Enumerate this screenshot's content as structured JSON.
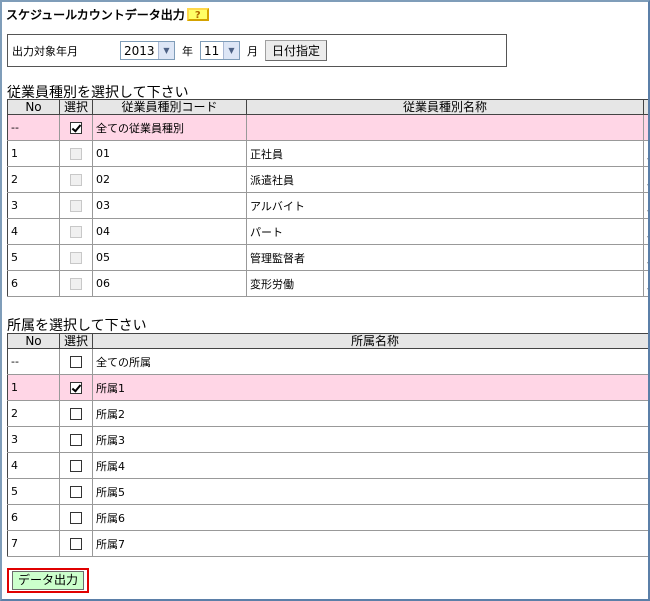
{
  "page": {
    "title": "スケジュールカウントデータ出力",
    "help_label": "?"
  },
  "filter": {
    "label": "出力対象年月",
    "year_value": "2013",
    "year_unit": "年",
    "month_value": "11",
    "month_unit": "月",
    "date_button": "日付指定"
  },
  "employee_section": {
    "title": "従業員種別を選択して下さい",
    "headers": [
      "No",
      "選択",
      "従業員種別コード",
      "従業員種別名称"
    ],
    "rows": [
      {
        "no": "--",
        "checked": true,
        "disabled": false,
        "code": "全ての従業員種別",
        "name": "",
        "extra": "ー",
        "highlight": true
      },
      {
        "no": "1",
        "checked": false,
        "disabled": true,
        "code": "01",
        "name": "正社員",
        "extra": "月",
        "highlight": false
      },
      {
        "no": "2",
        "checked": false,
        "disabled": true,
        "code": "02",
        "name": "派遣社員",
        "extra": "月",
        "highlight": false
      },
      {
        "no": "3",
        "checked": false,
        "disabled": true,
        "code": "03",
        "name": "アルバイト",
        "extra": "月",
        "highlight": false
      },
      {
        "no": "4",
        "checked": false,
        "disabled": true,
        "code": "04",
        "name": "パート",
        "extra": "月",
        "highlight": false
      },
      {
        "no": "5",
        "checked": false,
        "disabled": true,
        "code": "05",
        "name": "管理監督者",
        "extra": "月",
        "highlight": false
      },
      {
        "no": "6",
        "checked": false,
        "disabled": true,
        "code": "06",
        "name": "変形労働",
        "extra": "月",
        "highlight": false
      }
    ]
  },
  "dept_section": {
    "title": "所属を選択して下さい",
    "headers": [
      "No",
      "選択",
      "所属名称"
    ],
    "rows": [
      {
        "no": "--",
        "checked": false,
        "name": "全ての所属",
        "highlight": false
      },
      {
        "no": "1",
        "checked": true,
        "name": "所属1",
        "highlight": true
      },
      {
        "no": "2",
        "checked": false,
        "name": "所属2",
        "highlight": false
      },
      {
        "no": "3",
        "checked": false,
        "name": "所属3",
        "highlight": false
      },
      {
        "no": "4",
        "checked": false,
        "name": "所属4",
        "highlight": false
      },
      {
        "no": "5",
        "checked": false,
        "name": "所属5",
        "highlight": false
      },
      {
        "no": "6",
        "checked": false,
        "name": "所属6",
        "highlight": false
      },
      {
        "no": "7",
        "checked": false,
        "name": "所属7",
        "highlight": false
      }
    ]
  },
  "actions": {
    "output_button": "データ出力"
  }
}
